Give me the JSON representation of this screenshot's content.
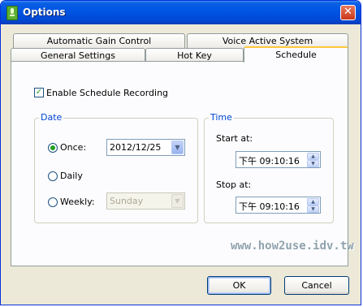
{
  "window": {
    "title": "Options",
    "close_glyph": "✕"
  },
  "tabs": {
    "row1": [
      "Automatic Gain Control",
      "Voice Active System"
    ],
    "row2": [
      "General Settings",
      "Hot Key",
      "Schedule"
    ],
    "active": "Schedule"
  },
  "schedule": {
    "enable_checkbox": {
      "label": "Enable Schedule Recording",
      "checked": true
    },
    "date_group": {
      "legend": "Date",
      "once": {
        "label": "Once:",
        "selected": true,
        "value": "2012/12/25"
      },
      "daily": {
        "label": "Daily",
        "selected": false
      },
      "weekly": {
        "label": "Weekly:",
        "selected": false,
        "value": "Sunday",
        "disabled": true
      }
    },
    "time_group": {
      "legend": "Time",
      "start_label": "Start at:",
      "start_value": "下午 09:10:16",
      "stop_label": "Stop at:",
      "stop_value": "下午 09:10:16"
    }
  },
  "buttons": {
    "ok": "OK",
    "cancel": "Cancel"
  },
  "watermark": "www.how2use.idv.tw",
  "icons": {
    "app": "app-icon",
    "close": "close-icon",
    "dropdown": "chevron-down-icon",
    "spin_up": "spin-up-icon",
    "spin_down": "spin-down-icon"
  },
  "colors": {
    "titlebar": "#0054e3",
    "group_legend": "#0046d5",
    "radio_checked": "#21a121",
    "tab_highlight": "#ffc83c"
  }
}
